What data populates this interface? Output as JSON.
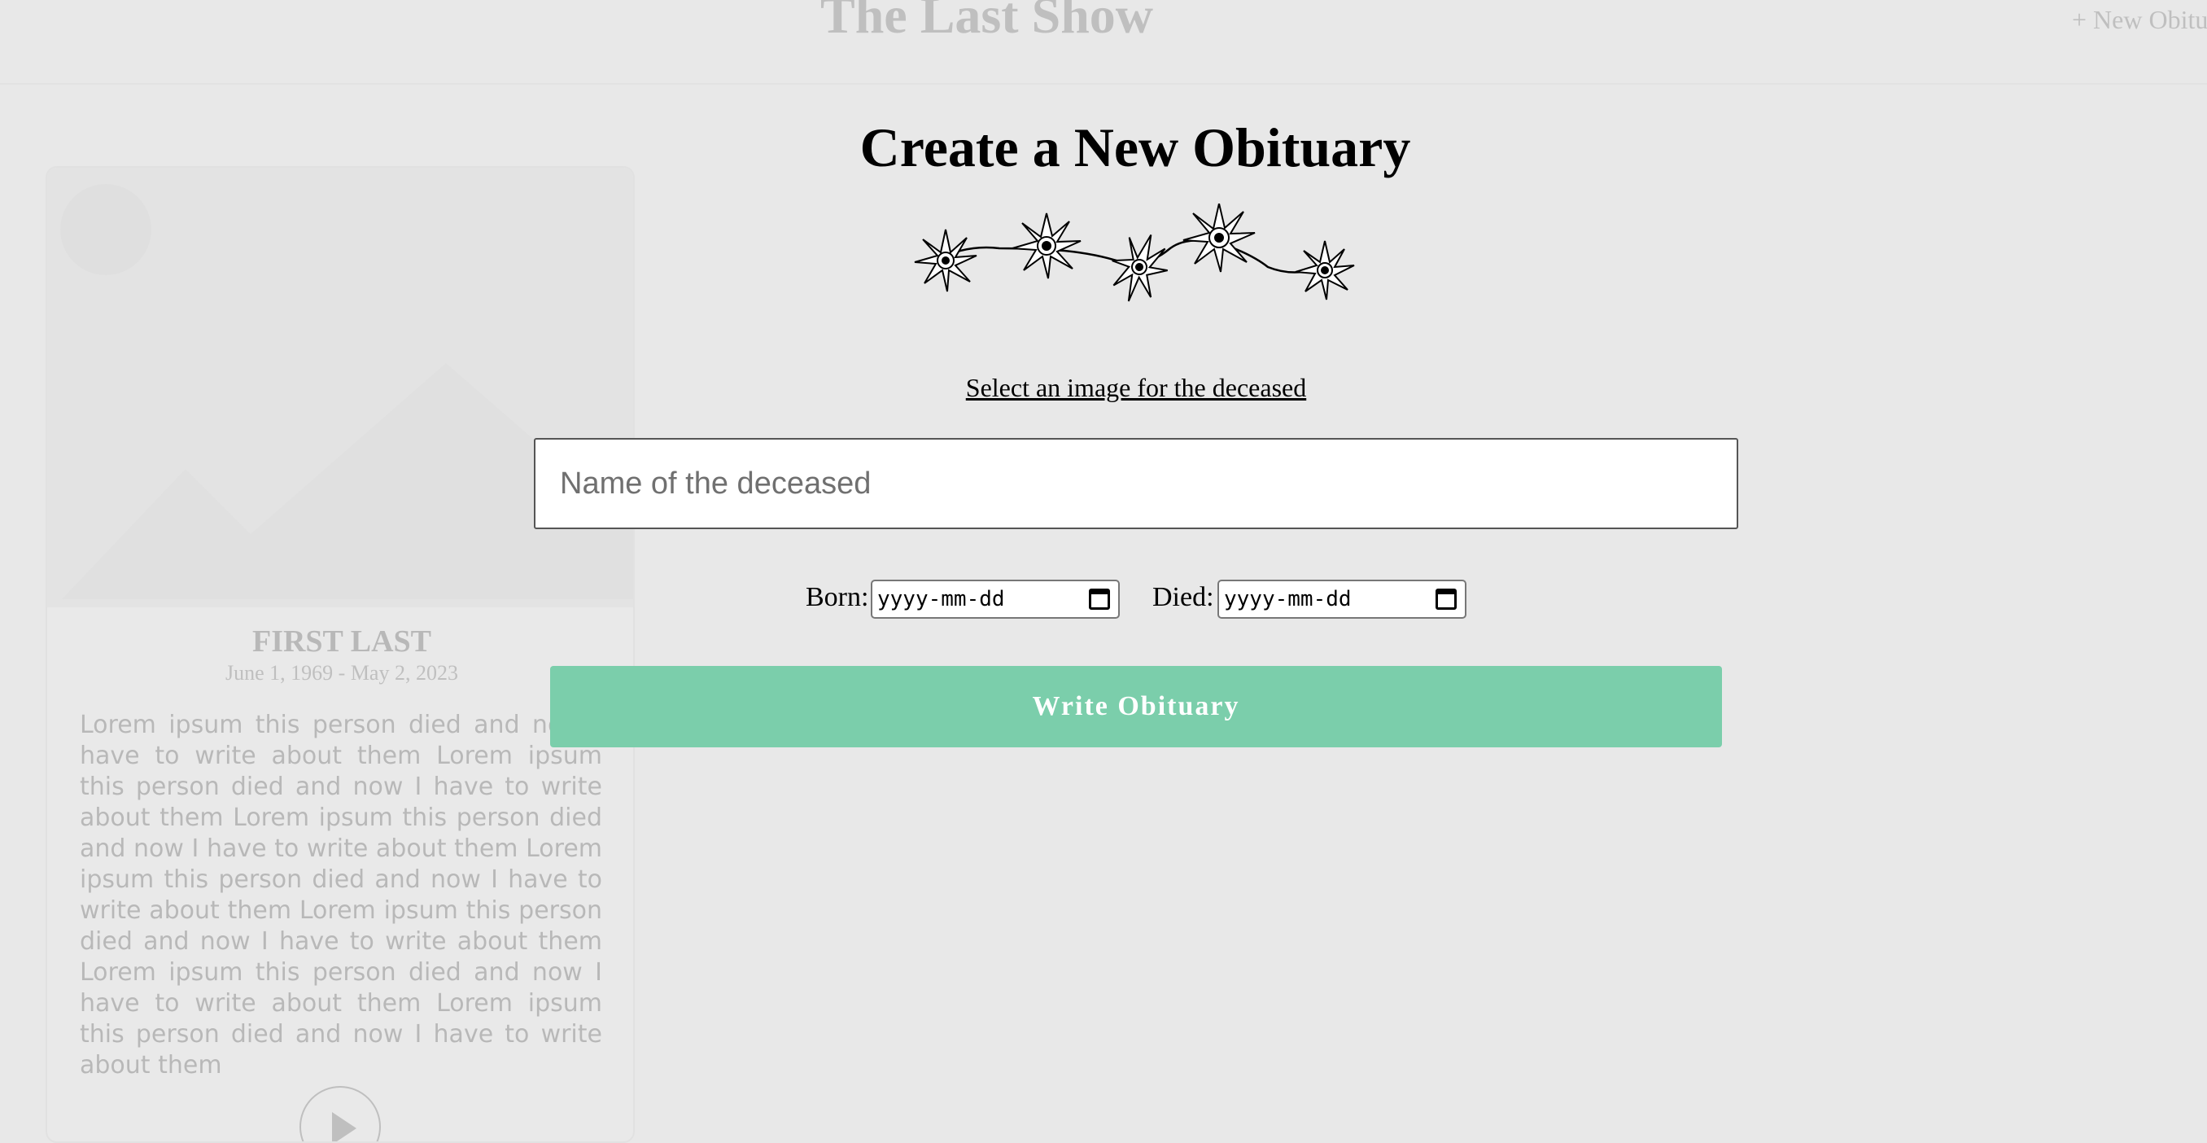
{
  "header": {
    "site_title": "The Last Show",
    "new_obituary_link": "+ New Obitu"
  },
  "background_card": {
    "name": "FIRST LAST",
    "dates": "June 1, 1969 - May 2, 2023",
    "text": "Lorem ipsum this person died and now I have to write about them Lorem ipsum this person died and now I have to write about them Lorem ipsum this person died and now I have to write about them Lorem ipsum this person died and now I have to write about them Lorem ipsum this person died and now I have to write about them Lorem ipsum this person died and now I have to write about them Lorem ipsum this person died and now I have to write about them"
  },
  "modal": {
    "title": "Create a New Obituary",
    "select_image_label": "Select an image for the deceased",
    "name_input": {
      "placeholder": "Name of the deceased",
      "value": ""
    },
    "born_label": "Born:",
    "born_value": "yyyy-mm-dd",
    "died_label": "Died:",
    "died_value": "yyyy-mm-dd",
    "submit_label": "Write Obituary",
    "accent_color": "#7bceab"
  },
  "icons": [
    "flower-garland-icon",
    "calendar-icon",
    "image-placeholder-icon",
    "play-icon"
  ]
}
